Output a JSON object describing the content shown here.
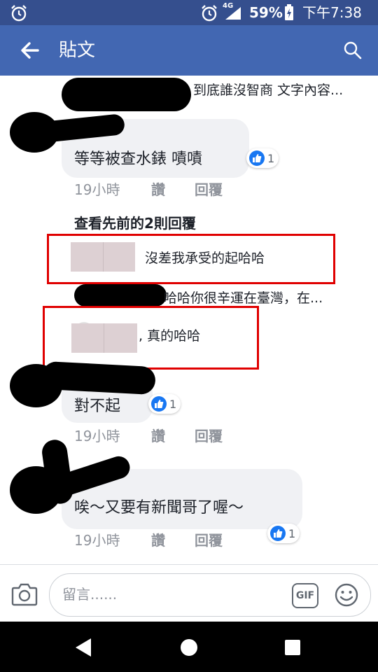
{
  "status_bar": {
    "network": "4G",
    "battery": "59%",
    "time": "下午7:38"
  },
  "app_bar": {
    "title": "貼文"
  },
  "comments": {
    "top_snippet": "到底誰沒智商 文字內容...",
    "c1": {
      "text": "等等被查水錶 嘖嘖",
      "reactions": "1",
      "time": "19小時",
      "like": "讚",
      "reply": "回覆"
    },
    "view_previous": "查看先前的2則回覆",
    "r1": {
      "text": "沒差我承受的起哈哈"
    },
    "r2": {
      "text": "哈哈你很辛運在臺灣，在..."
    },
    "r3": {
      "text": ", 真的哈哈"
    },
    "c2": {
      "text": "對不起",
      "reactions": "1",
      "time": "19小時",
      "like": "讚",
      "reply": "回覆"
    },
    "c3": {
      "text": "唉～又要有新聞哥了喔～",
      "reactions": "1",
      "time": "19小時",
      "like": "讚",
      "reply": "回覆"
    }
  },
  "composer": {
    "placeholder": "留言......",
    "gif_label": "GIF"
  },
  "colors": {
    "appbar": "#4267b2",
    "statusbar": "#354f8e",
    "highlight": "#e00000",
    "like_blue": "#1877f2"
  }
}
